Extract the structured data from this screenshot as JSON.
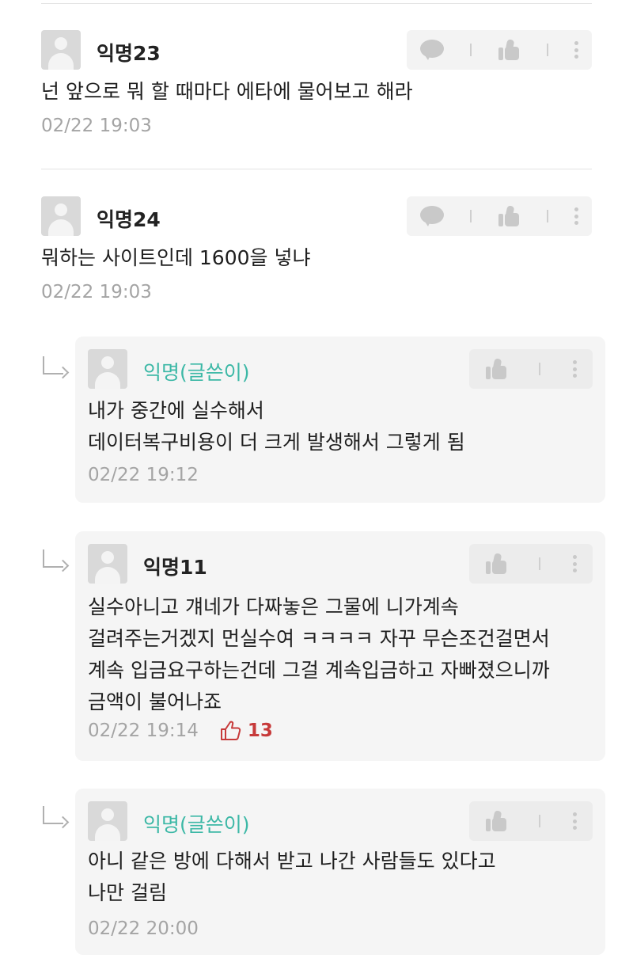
{
  "comments": [
    {
      "nickname": "익명23",
      "lines": [
        "넌 앞으로 뭐 할 때마다 에타에 물어보고 해라"
      ],
      "timestamp": "02/22 19:03"
    },
    {
      "nickname": "익명24",
      "lines": [
        "뭐하는 사이트인데 1600을 넣냐"
      ],
      "timestamp": "02/22 19:03"
    }
  ],
  "replies": [
    {
      "nickname": "익명(글쓴이)",
      "is_writer": true,
      "lines": [
        "내가 중간에 실수해서",
        "데이터복구비용이 더 크게 발생해서 그렇게 됨"
      ],
      "timestamp": "02/22 19:12"
    },
    {
      "nickname": "익명11",
      "is_writer": false,
      "lines": [
        "실수아니고 걔네가 다짜놓은 그물에 니가계속",
        "걸려주는거겠지 먼실수여 ㅋㅋㅋㅋ 자꾸 무슨조건걸면서",
        "계속 입금요구하는건데 그걸 계속입금하고 자빠졌으니까",
        "금액이 불어나죠"
      ],
      "timestamp": "02/22 19:14",
      "vote_count": "13"
    },
    {
      "nickname": "익명(글쓴이)",
      "is_writer": true,
      "lines": [
        "아니 같은 방에 다해서 받고 나간 사람들도 있다고",
        "나만 걸림"
      ],
      "timestamp": "02/22 20:00"
    }
  ],
  "colors": {
    "writer_nickname": "#3cb8a6",
    "vote": "#c73a3a",
    "timestamp": "#a4a4a4",
    "reply_background": "#f5f5f5"
  },
  "icons": [
    "comment-icon",
    "thumbs-up-icon",
    "more-icon",
    "reply-arrow-icon",
    "vote-icon"
  ]
}
